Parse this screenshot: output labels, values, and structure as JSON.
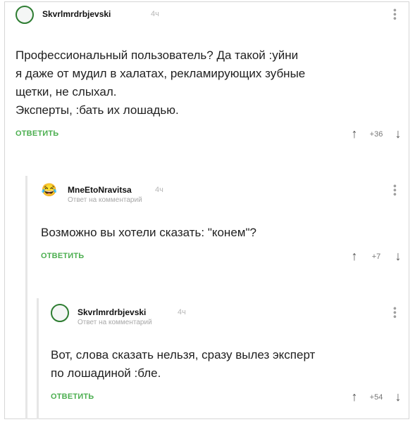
{
  "comments": [
    {
      "user": "Skvrlmrdrbjevski",
      "time": "4ч",
      "reply_to": "",
      "avatar": "ring-avatar",
      "text_lines": [
        "Профессиональный пользователь? Да такой :уйни",
        "я даже от мудил в халатах, рекламирующих зубные",
        "щетки, не слыхал.",
        "Эксперты, :бать их лошадью."
      ],
      "reply_label": "ОТВЕТИТЬ",
      "score": "+36"
    },
    {
      "user": "MneEtoNravitsa",
      "time": "4ч",
      "reply_to": "Ответ на комментарий",
      "avatar": "emoji-avatar",
      "avatar_glyph": "😂",
      "text_lines": [
        "Возможно вы хотели сказать: \"конем\"?"
      ],
      "reply_label": "ОТВЕТИТЬ",
      "score": "+7"
    },
    {
      "user": "Skvrlmrdrbjevski",
      "time": "4ч",
      "reply_to": "Ответ на комментарий",
      "avatar": "ring-avatar",
      "text_lines": [
        "Вот, слова сказать нельзя, сразу вылез эксперт",
        "по лошадиной :бле."
      ],
      "reply_label": "ОТВЕТИТЬ",
      "score": "+54"
    }
  ],
  "icons": {
    "more": "more-vertical-icon",
    "upvote": "arrow-up-icon",
    "downvote": "arrow-down-icon"
  },
  "colors": {
    "accent": "#4caf50",
    "avatar_ring": "#2e7d32",
    "muted": "#a8a8a8"
  }
}
